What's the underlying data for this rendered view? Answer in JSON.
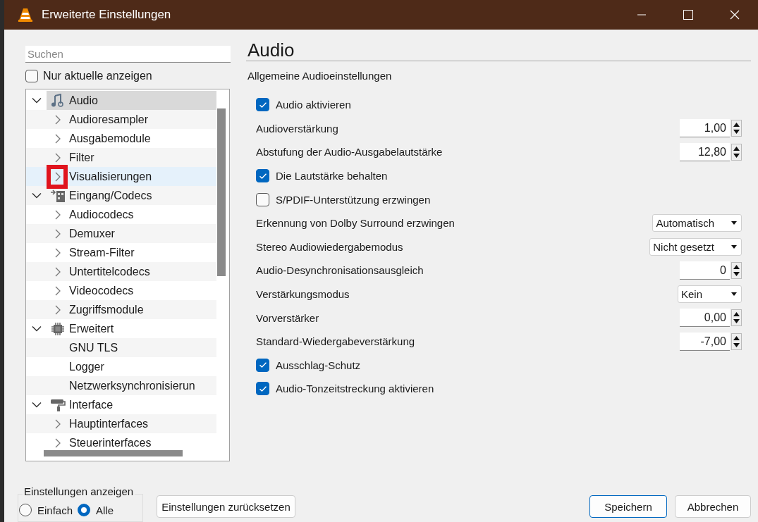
{
  "window": {
    "title": "Erweiterte Einstellungen"
  },
  "search": {
    "placeholder": "Suchen"
  },
  "only_current": {
    "label": "Nur aktuelle anzeigen",
    "checked": false
  },
  "tree": [
    {
      "label": "Audio",
      "kind": "music",
      "expanded": true,
      "selected": true,
      "hovered": false,
      "children": [
        {
          "label": "Audioresampler",
          "kind": "module",
          "expanded": false,
          "selected": false,
          "hovered": false
        },
        {
          "label": "Ausgabemodule",
          "kind": "module",
          "expanded": false,
          "selected": false,
          "hovered": false
        },
        {
          "label": "Filter",
          "kind": "module",
          "expanded": false,
          "selected": false,
          "hovered": false
        },
        {
          "label": "Visualisierungen",
          "kind": "module",
          "expanded": false,
          "selected": false,
          "hovered": true,
          "annotated": true
        }
      ]
    },
    {
      "label": "Eingang/Codecs",
      "kind": "input",
      "expanded": true,
      "selected": false,
      "hovered": false,
      "children": [
        {
          "label": "Audiocodecs",
          "kind": "module",
          "expanded": false,
          "selected": false,
          "hovered": false
        },
        {
          "label": "Demuxer",
          "kind": "module",
          "expanded": false,
          "selected": false,
          "hovered": false
        },
        {
          "label": "Stream-Filter",
          "kind": "module",
          "expanded": false,
          "selected": false,
          "hovered": false
        },
        {
          "label": "Untertitelcodecs",
          "kind": "module",
          "expanded": false,
          "selected": false,
          "hovered": false
        },
        {
          "label": "Videocodecs",
          "kind": "module",
          "expanded": false,
          "selected": false,
          "hovered": false
        },
        {
          "label": "Zugriffsmodule",
          "kind": "module",
          "expanded": false,
          "selected": false,
          "hovered": false
        }
      ]
    },
    {
      "label": "Erweitert",
      "kind": "chip",
      "expanded": true,
      "selected": false,
      "hovered": false,
      "children": [
        {
          "label": "GNU TLS",
          "kind": "leaf",
          "selected": false,
          "hovered": false
        },
        {
          "label": "Logger",
          "kind": "leaf",
          "selected": false,
          "hovered": false
        },
        {
          "label": "Netzwerksynchronisierun",
          "kind": "leaf",
          "selected": false,
          "hovered": false
        }
      ]
    },
    {
      "label": "Interface",
      "kind": "brush",
      "expanded": true,
      "selected": false,
      "hovered": false,
      "children": [
        {
          "label": "Hauptinterfaces",
          "kind": "module",
          "expanded": false,
          "selected": false,
          "hovered": false
        },
        {
          "label": "Steuerinterfaces",
          "kind": "module",
          "expanded": false,
          "selected": false,
          "hovered": false
        }
      ]
    }
  ],
  "panel": {
    "title": "Audio",
    "subtitle": "Allgemeine Audioeinstellungen",
    "settings": [
      {
        "kind": "checkbox",
        "label": "Audio aktivieren",
        "checked": true
      },
      {
        "kind": "spin",
        "label": "Audioverstärkung",
        "value": "1,00"
      },
      {
        "kind": "spin",
        "label": "Abstufung der Audio-Ausgabelautstärke",
        "value": "12,80"
      },
      {
        "kind": "checkbox",
        "label": "Die Lautstärke behalten",
        "checked": true
      },
      {
        "kind": "checkbox",
        "label": "S/PDIF-Unterstützung erzwingen",
        "checked": false
      },
      {
        "kind": "select",
        "label": "Erkennung von Dolby Surround erzwingen",
        "value": "Automatisch"
      },
      {
        "kind": "select",
        "label": "Stereo Audiowiedergabemodus",
        "value": "Nicht gesetzt"
      },
      {
        "kind": "spin",
        "label": "Audio-Desynchronisationsausgleich",
        "value": "0"
      },
      {
        "kind": "select",
        "label": "Verstärkungsmodus",
        "value": "Kein"
      },
      {
        "kind": "spin",
        "label": "Vorverstärker",
        "value": "0,00"
      },
      {
        "kind": "spin",
        "label": "Standard-Wiedergabeverstärkung",
        "value": "-7,00"
      },
      {
        "kind": "checkbox",
        "label": "Ausschlag-Schutz",
        "checked": true
      },
      {
        "kind": "checkbox",
        "label": "Audio-Tonzeitstreckung aktivieren",
        "checked": true
      }
    ]
  },
  "view_mode": {
    "title": "Einstellungen anzeigen",
    "options": [
      {
        "label": "Einfach",
        "selected": false
      },
      {
        "label": "Alle",
        "selected": true
      }
    ]
  },
  "buttons": {
    "reset": "Einstellungen zurücksetzen",
    "save": "Speichern",
    "cancel": "Abbrechen"
  }
}
